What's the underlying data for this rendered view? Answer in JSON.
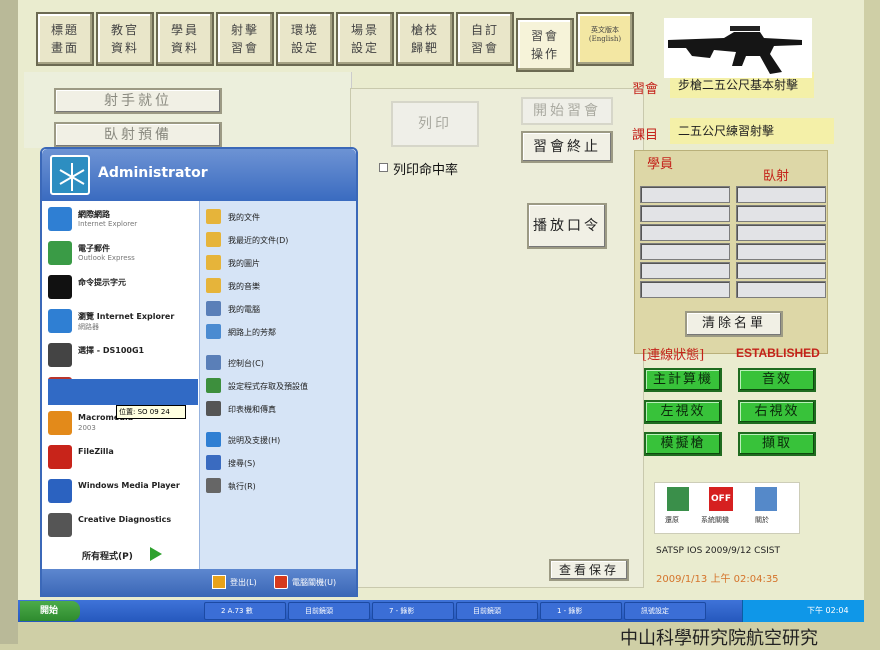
{
  "tabs": [
    {
      "label": "標題\n畫面"
    },
    {
      "label": "教官\n資料"
    },
    {
      "label": "學員\n資料"
    },
    {
      "label": "射擊\n習會"
    },
    {
      "label": "環境\n設定"
    },
    {
      "label": "場景\n設定"
    },
    {
      "label": "槍枝\n歸靶"
    },
    {
      "label": "自訂\n習會"
    },
    {
      "label": "習會\n操作"
    },
    {
      "label": "英文版本\n(English)"
    }
  ],
  "left_buttons": {
    "shooter_position": "射手就位",
    "team_shoot": "臥射預備"
  },
  "center": {
    "print": "列印",
    "start": "開始習會",
    "stop": "習會終止",
    "play": "播放口令",
    "print_hit_rate": "列印命中率",
    "watch": "查看保存"
  },
  "right": {
    "session_label": "習會",
    "session_value": "步槍二五公尺基本射擊",
    "subject_label": "課目",
    "subject_value": "二五公尺練習射擊",
    "students_label": "學員",
    "lane_label": "臥射",
    "clear_list": "清除名單",
    "conn_label": "[連線狀態]",
    "conn_status": "ESTABLISHED",
    "green_buttons": [
      "主計算機",
      "音效",
      "左視效",
      "右視效",
      "模擬槍",
      "擷取"
    ],
    "icons": [
      "還原",
      "系統關機",
      "關於"
    ],
    "version": "SATSP IOS 2009/9/12  CSIST",
    "datetime": "2009/1/13 上午 02:04:35"
  },
  "startmenu": {
    "user": "Administrator",
    "left_items": [
      {
        "t1": "網際網路",
        "t2": "Internet Explorer",
        "icon": "ie-icon"
      },
      {
        "t1": "電子郵件",
        "t2": "Outlook Express",
        "icon": "mail-icon"
      },
      {
        "t1": "命令提示字元",
        "t2": "",
        "icon": "cmd-icon"
      },
      {
        "t1": "瀏覽 Internet Explorer",
        "t2": "網路器",
        "icon": "ie-icon"
      },
      {
        "t1": "選擇 - DS100G1",
        "t2": "",
        "icon": "cd-icon"
      },
      {
        "t1": "光碟燒錄程式",
        "t2": "",
        "icon": "app-icon"
      },
      {
        "t1": "Macromedia",
        "t2": "2003",
        "icon": "mx-icon"
      },
      {
        "t1": "FileZilla",
        "t2": "",
        "icon": "filezilla-icon"
      },
      {
        "t1": "Windows Media Player",
        "t2": "",
        "icon": "media-icon"
      },
      {
        "t1": "Creative Diagnostics",
        "t2": "",
        "icon": "creative-icon"
      }
    ],
    "tooltip": "位置: SO 09 24",
    "all_programs": "所有程式(P)",
    "right_items": [
      {
        "t1": "我的文件",
        "icon": "folder-icon"
      },
      {
        "t1": "我最近的文件(D)",
        "icon": "recent-icon"
      },
      {
        "t1": "我的圖片",
        "icon": "pictures-icon"
      },
      {
        "t1": "我的音樂",
        "icon": "music-icon"
      },
      {
        "t1": "我的電腦",
        "icon": "computer-icon"
      },
      {
        "t1": "網路上的芳鄰",
        "icon": "network-icon"
      },
      {
        "t1": "控制台(C)",
        "icon": "control-icon"
      },
      {
        "t1": "設定程式存取及預設值",
        "icon": "defaults-icon"
      },
      {
        "t1": "印表機和傳真",
        "icon": "printer-icon"
      },
      {
        "t1": "說明及支援(H)",
        "icon": "help-icon"
      },
      {
        "t1": "搜尋(S)",
        "icon": "search-icon"
      },
      {
        "t1": "執行(R)",
        "icon": "run-icon"
      }
    ],
    "logoff": "登出(L)",
    "shutdown": "電腦關機(U)"
  },
  "taskbar": {
    "start": "開始",
    "items": [
      "2 A.73 數",
      "目前鏡頭",
      "7 - 錄影",
      "目前鏡頭",
      "1 - 錄影",
      "訊號設定"
    ],
    "clock": "下午 02:04"
  },
  "caption": "中山科學研究院航空研究"
}
